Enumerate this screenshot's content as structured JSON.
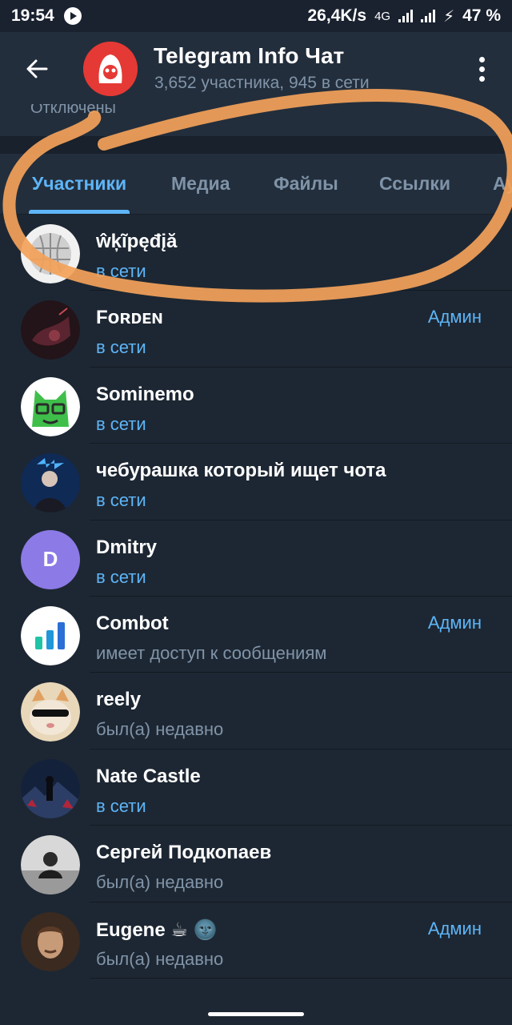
{
  "status_bar": {
    "time": "19:54",
    "net_speed": "26,4K/s",
    "network": "4G",
    "battery": "47 %"
  },
  "header": {
    "title": "Telegram Info Чат",
    "subtitle": "3,652 участника, 945 в сети"
  },
  "settings_row": {
    "notifications_value": "Отключены"
  },
  "tabs": [
    {
      "label": "Участники",
      "active": true
    },
    {
      "label": "Медиа",
      "active": false
    },
    {
      "label": "Файлы",
      "active": false
    },
    {
      "label": "Ссылки",
      "active": false
    },
    {
      "label": "Ау",
      "active": false
    }
  ],
  "members": [
    {
      "name": "ŵķĩpęđįă",
      "status": "в сети",
      "online": true,
      "role": "",
      "avatar": "wikipedia-globe"
    },
    {
      "name": "Fᴏʀᴅᴇɴ",
      "status": "в сети",
      "online": true,
      "role": "Админ",
      "avatar": "dark-art"
    },
    {
      "name": "Sominemo",
      "status": "в сети",
      "online": true,
      "role": "",
      "avatar": "green-cat"
    },
    {
      "name": "чебурашка который ищет чота",
      "status": "в сети",
      "online": true,
      "role": "",
      "avatar": "concert-photo"
    },
    {
      "name": "Dmitry",
      "status": "в сети",
      "online": true,
      "role": "",
      "avatar": "letter-D",
      "avatar_letter": "D",
      "avatar_color": "#8c7ae6"
    },
    {
      "name": "Combot",
      "status": "имеет доступ к сообщениям",
      "online": false,
      "role": "Админ",
      "avatar": "bar-chart-logo"
    },
    {
      "name": "reely",
      "status": "был(а) недавно",
      "online": false,
      "role": "",
      "avatar": "cat-sunglasses"
    },
    {
      "name": "Nate Castle",
      "status": "в сети",
      "online": true,
      "role": "",
      "avatar": "dark-landscape"
    },
    {
      "name": "Сергей Подкопаев",
      "status": "был(а) недавно",
      "online": false,
      "role": "",
      "avatar": "bw-photo"
    },
    {
      "name": "Eugene ☕ 🌚",
      "status": "был(а) недавно",
      "online": false,
      "role": "Админ",
      "avatar": "man-portrait"
    }
  ],
  "colors": {
    "accent": "#5eb5f7",
    "background": "#1d2733",
    "header": "#232e3c",
    "annotation": "#f4a25a"
  }
}
